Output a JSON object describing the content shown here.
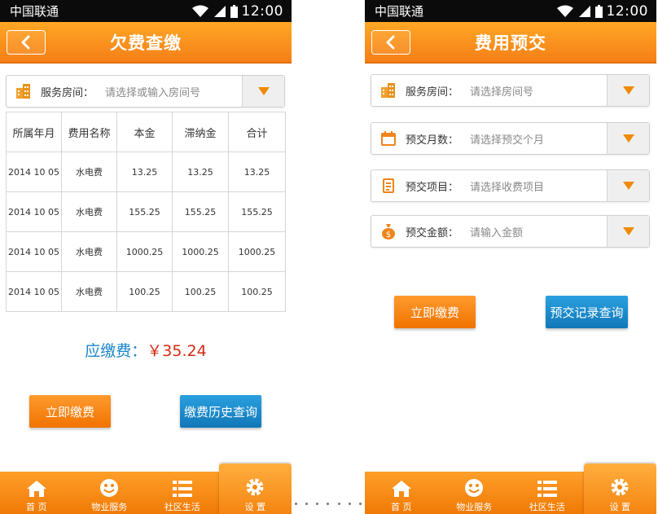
{
  "status": {
    "carrier": "中国联通",
    "time": "12:00"
  },
  "left": {
    "title": "欠费查缴",
    "room_label": "服务房间：",
    "room_placeholder": "请选择或输入房间号",
    "table": {
      "headers": [
        "所属年月",
        "费用名称",
        "本金",
        "滞纳金",
        "合计"
      ],
      "rows": [
        [
          "2014 10 05",
          "水电费",
          "13.25",
          "13.25",
          "13.25"
        ],
        [
          "2014 10 05",
          "水电费",
          "155.25",
          "155.25",
          "155.25"
        ],
        [
          "2014 10 05",
          "水电费",
          "1000.25",
          "1000.25",
          "1000.25"
        ],
        [
          "2014 10 05",
          "水电费",
          "100.25",
          "100.25",
          "100.25"
        ]
      ]
    },
    "total_label": "应缴费：",
    "total_value": "￥35.24",
    "pay_button": "立即缴费",
    "history_button": "缴费历史查询"
  },
  "right": {
    "title": "费用预交",
    "fields": [
      {
        "icon": "building-icon",
        "label": "服务房间：",
        "placeholder": "请选择房间号"
      },
      {
        "icon": "calendar-icon",
        "label": "预交月数：",
        "placeholder": "请选择预交个月"
      },
      {
        "icon": "document-icon",
        "label": "预交项目：",
        "placeholder": "请选择收费项目"
      },
      {
        "icon": "money-bag-icon",
        "label": "预交金额：",
        "placeholder": "请输入金额"
      }
    ],
    "pay_button": "立即缴费",
    "records_button": "预交记录查询"
  },
  "tabs": [
    "首 页",
    "物业服务",
    "社区生活",
    "设 置"
  ],
  "colors": {
    "accent": "#f57f17",
    "blue": "#1a86c7",
    "price": "#d42a12"
  }
}
